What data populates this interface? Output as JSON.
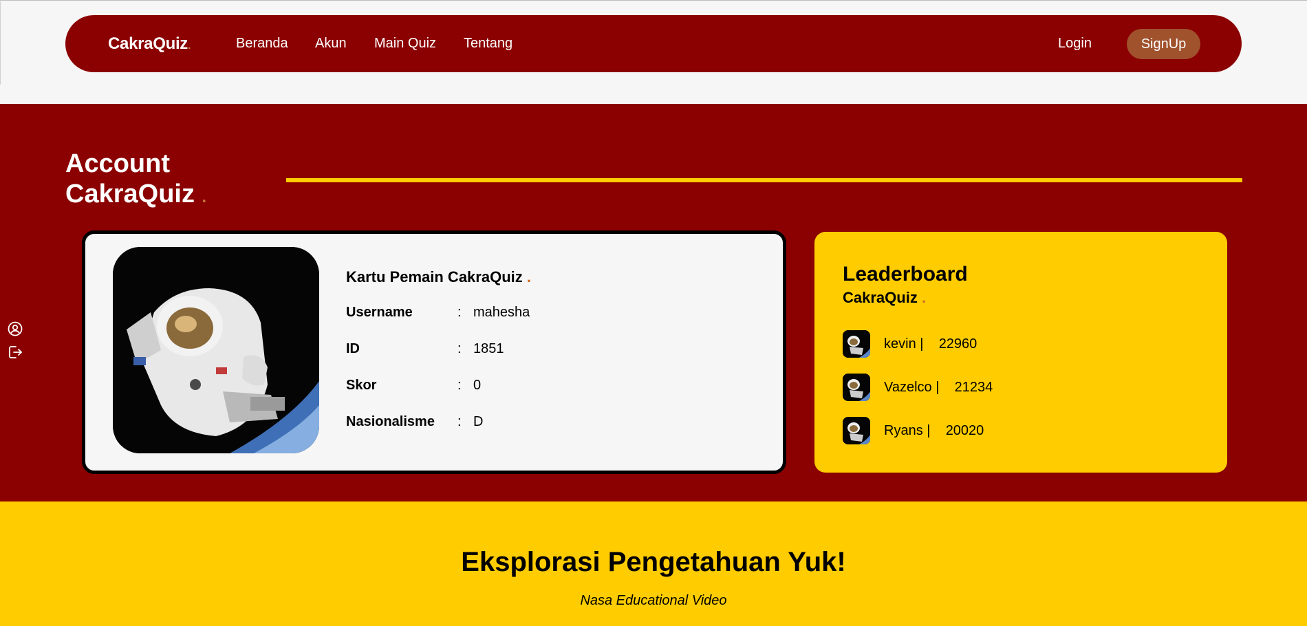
{
  "navbar": {
    "brand": "CakraQuiz",
    "brand_dot": ".",
    "links": [
      "Beranda",
      "Akun",
      "Main Quiz",
      "Tentang"
    ],
    "login": "Login",
    "signup": "SignUp"
  },
  "account": {
    "title_line1": "Account",
    "title_line2": "CakraQuiz",
    "title_dot": "."
  },
  "sidebar": {
    "icons": [
      "user-circle-icon",
      "logout-icon"
    ]
  },
  "player_card": {
    "title": "Kartu Pemain CakraQuiz",
    "title_dot": ".",
    "separator": ":",
    "rows": [
      {
        "label": "Username",
        "value": "mahesha"
      },
      {
        "label": "ID",
        "value": "1851"
      },
      {
        "label": "Skor",
        "value": "0"
      },
      {
        "label": "Nasionalisme",
        "value": "D"
      }
    ]
  },
  "leaderboard": {
    "title": "Leaderboard",
    "subtitle": "CakraQuiz",
    "subtitle_dot": ".",
    "entries": [
      {
        "name": "kevin |",
        "score": "22960"
      },
      {
        "name": "Vazelco |",
        "score": "21234"
      },
      {
        "name": "Ryans |",
        "score": "20020"
      }
    ]
  },
  "explore": {
    "title": "Eksplorasi Pengetahuan Yuk!",
    "subtitle": "Nasa Educational Video"
  },
  "colors": {
    "primary": "#8b0000",
    "accent": "#ffcc00",
    "signup_bg": "#a0522d"
  }
}
